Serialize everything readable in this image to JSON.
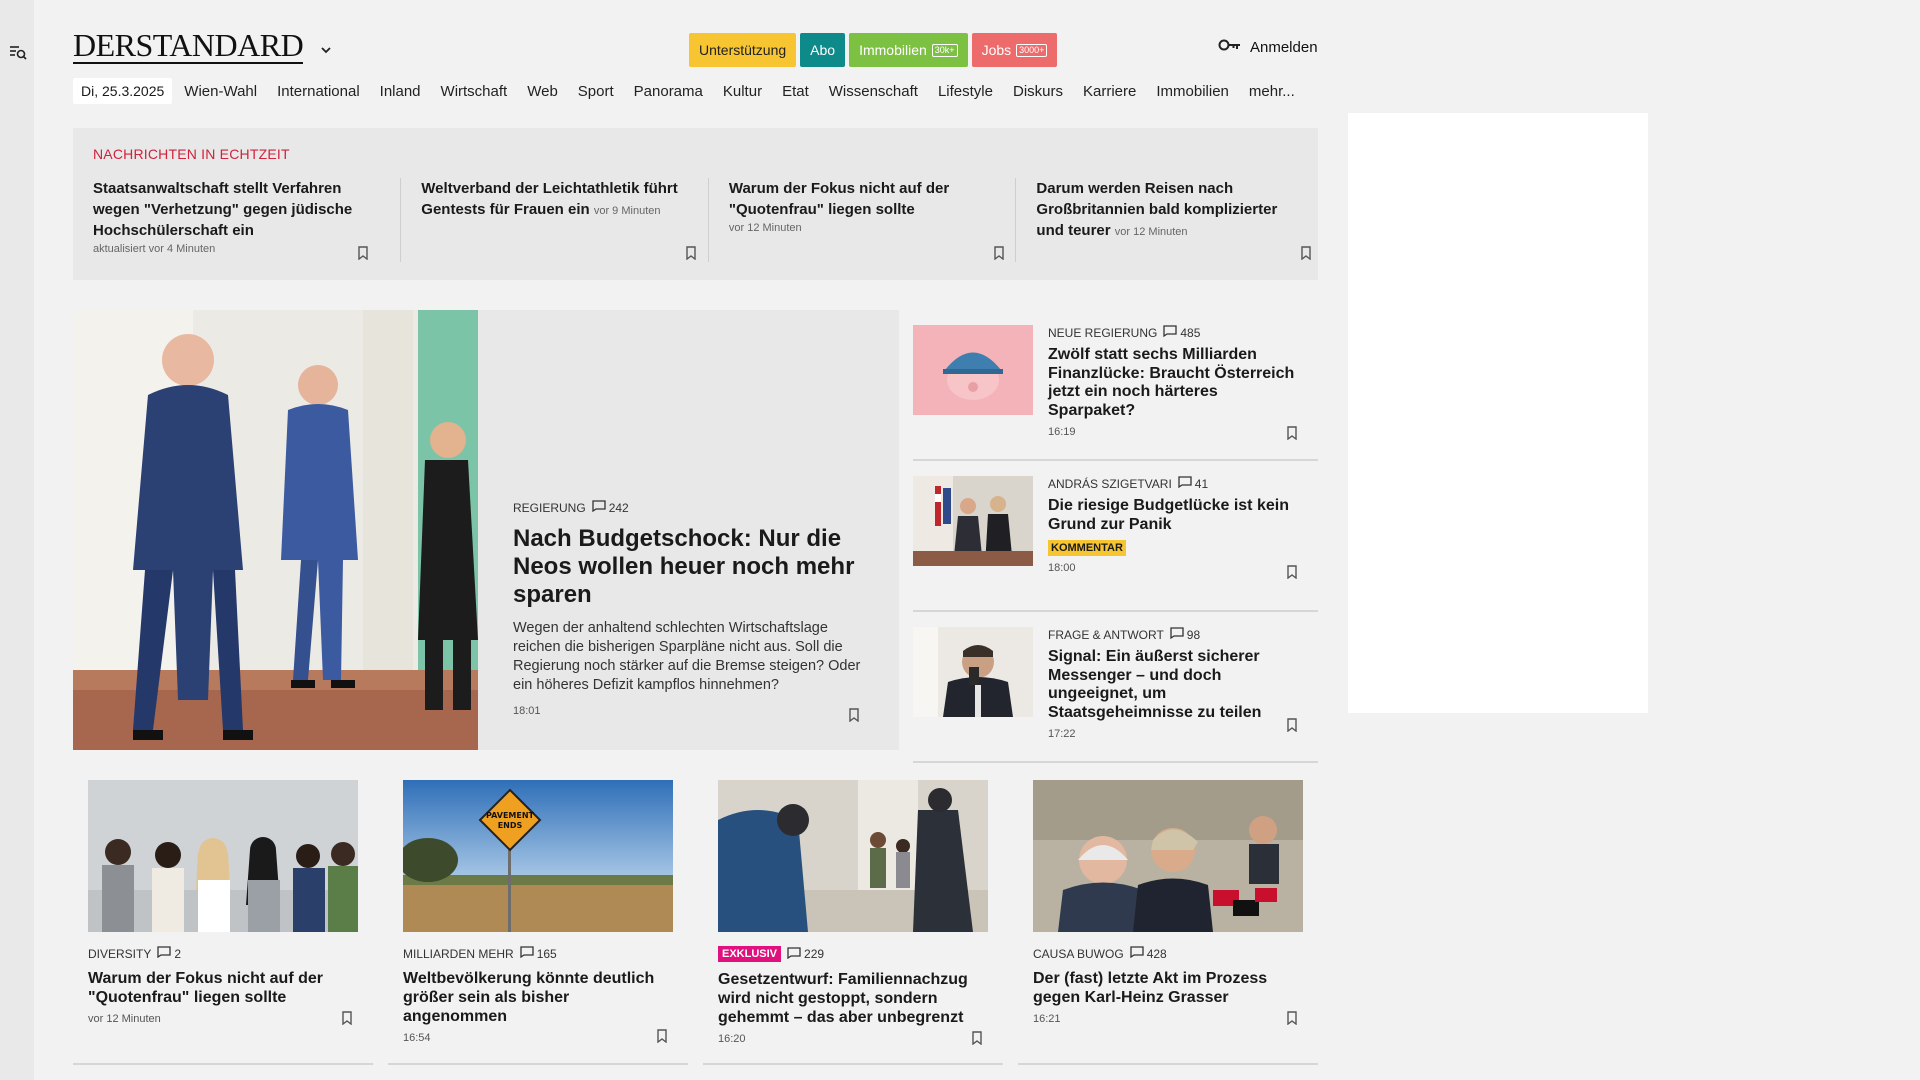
{
  "header": {
    "logo": "DERSTANDARD",
    "buttons": {
      "support": "Unterstützung",
      "abo": "Abo",
      "immobilien": "Immobilien",
      "immobilien_badge": "30k+",
      "jobs": "Jobs",
      "jobs_badge": "3000+"
    },
    "login": "Anmelden"
  },
  "nav": {
    "date": "Di, 25.3.2025",
    "items": [
      "Wien-Wahl",
      "International",
      "Inland",
      "Wirtschaft",
      "Web",
      "Sport",
      "Panorama",
      "Kultur",
      "Etat",
      "Wissenschaft",
      "Lifestyle",
      "Diskurs",
      "Karriere",
      "Immobilien",
      "mehr..."
    ]
  },
  "live": {
    "heading": "NACHRICHTEN IN ECHTZEIT",
    "items": [
      {
        "title": "Staatsanwaltschaft stellt Verfahren wegen \"Verhetzung\" gegen jüdische Hochschülerschaft ein",
        "meta": "aktualisiert vor 4 Minuten"
      },
      {
        "title": "Weltverband der Leichtathletik führt Gentests für Frauen ein",
        "meta": "vor 9 Minuten"
      },
      {
        "title": "Warum der Fokus nicht auf der \"Quotenfrau\" liegen sollte",
        "meta": "vor 12 Minuten"
      },
      {
        "title": "Darum werden Reisen nach Großbritannien bald komplizierter und teurer",
        "meta": "vor 12 Minuten"
      }
    ]
  },
  "hero": {
    "kicker": "REGIERUNG",
    "comments": "242",
    "title": "Nach Budgetschock: Nur die Neos wollen heuer noch mehr sparen",
    "lead": "Wegen der anhaltend schlechten Wirtschaftslage reichen die bisherigen Sparpläne nicht aus. Soll die Regierung noch stärker auf die Bremse steigen? Oder ein höheres Defizit kampflos hinnehmen?",
    "time": "18:01"
  },
  "side": [
    {
      "kicker": "NEUE REGIERUNG",
      "comments": "485",
      "title": "Zwölf statt sechs Milliarden Finanzlücke: Braucht Österreich jetzt ein noch härteres Sparpaket?",
      "badge": "",
      "time": "16:19"
    },
    {
      "kicker": "ANDRÁS SZIGETVARI",
      "comments": "41",
      "title": "Die riesige Budgetlücke ist kein Grund zur Panik",
      "badge": "KOMMENTAR",
      "time": "18:00"
    },
    {
      "kicker": "FRAGE & ANTWORT",
      "comments": "98",
      "title": "Signal: Ein äußerst sicherer Messenger – und doch ungeeignet, um Staatsgeheimnisse zu teilen",
      "badge": "",
      "time": "17:22"
    }
  ],
  "cards": [
    {
      "kicker": "DIVERSITY",
      "badge": "",
      "comments": "2",
      "title": "Warum der Fokus nicht auf der \"Quotenfrau\" liegen sollte",
      "time": "vor 12 Minuten"
    },
    {
      "kicker": "MILLIARDEN MEHR",
      "badge": "",
      "comments": "165",
      "title": "Weltbevölkerung könnte deutlich größer sein als bisher angenommen",
      "time": "16:54"
    },
    {
      "kicker": "",
      "badge": "EXKLUSIV",
      "comments": "229",
      "title": "Gesetzentwurf: Familiennachzug wird nicht gestoppt, sondern gehemmt – das aber unbegrenzt",
      "time": "16:20"
    },
    {
      "kicker": "CAUSA BUWOG",
      "badge": "",
      "comments": "428",
      "title": "Der (fast) letzte Akt im Prozess gegen Karl-Heinz Grasser",
      "time": "16:21"
    }
  ],
  "image_text": {
    "road_sign": "PAVEMENT ENDS"
  },
  "colors": {
    "accent_red": "#d0223c",
    "support": "#f6c531",
    "abo": "#0f8a8a",
    "immobilien": "#7dc142",
    "jobs": "#ee6b6b",
    "exklusiv": "#e0107c"
  }
}
